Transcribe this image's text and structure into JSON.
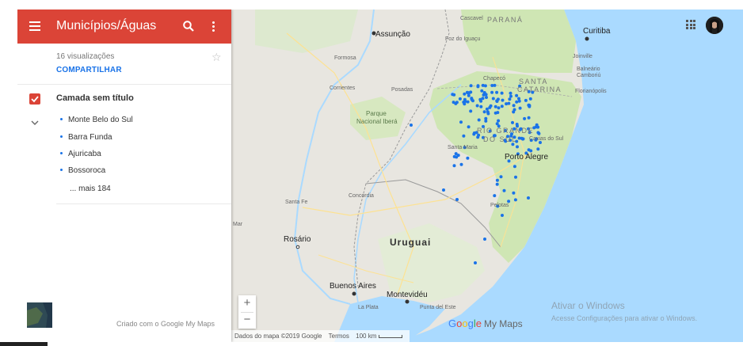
{
  "sidebar": {
    "title": "Municípios/Águas",
    "views": "16 visualizações",
    "share_label": "COMPARTILHAR",
    "layer": {
      "name": "Camada sem título",
      "items": [
        "Monte Belo do Sul",
        "Barra Funda",
        "Ajuricaba",
        "Bossoroca"
      ],
      "more": "... mais 184"
    },
    "created_by": "Criado com o Google My Maps"
  },
  "map": {
    "labels": {
      "cascavel": "Cascavel",
      "parana": "PARANÁ",
      "curitiba": "Curitiba",
      "assuncao": "Assunção",
      "foz": "Foz do Iguaçu",
      "joinville": "Joinville",
      "balneario": "Balneário",
      "camboriu": "Camboriú",
      "formosa": "Formosa",
      "chapeco": "Chapecó",
      "santa": "SANTA",
      "catarina": "CATARINA",
      "florianopolis": "Florianópolis",
      "corrientes": "Corrientes",
      "posadas": "Posadas",
      "parque": "Parque",
      "nacional_ibera": "Nacional Iberá",
      "rio_grande": "RIO GRANDE",
      "do_sul": "DO SUL",
      "caxias": "Caxias do Sul",
      "santa_maria": "Santa Maria",
      "porto_alegre": "Porto Alegre",
      "concordia": "Concordia",
      "santa_fe": "Santa Fe",
      "pelotas": "Pelotas",
      "mar": "Mar",
      "rosario": "Rosário",
      "uruguai": "Uruguai",
      "buenos_aires": "Buenos Aires",
      "montevideu": "Montevidéu",
      "la_plata": "La Plata",
      "punta": "Punta del Este"
    },
    "attribution": "Dados do mapa ©2019 Google",
    "terms": "Termos",
    "scale": "100 km",
    "brand_google": [
      "G",
      "o",
      "o",
      "g",
      "l",
      "e"
    ],
    "brand_mymaps": "My Maps",
    "zoom_in": "+",
    "zoom_out": "−"
  },
  "watermark": {
    "line1": "Ativar o Windows",
    "line2": "Acesse Configurações para ativar o Windows."
  },
  "colors": {
    "header": "#db4437",
    "marker": "#1a73e8",
    "land": "#e8e6e0",
    "green": "#cfe6b4",
    "water": "#aadaff"
  }
}
